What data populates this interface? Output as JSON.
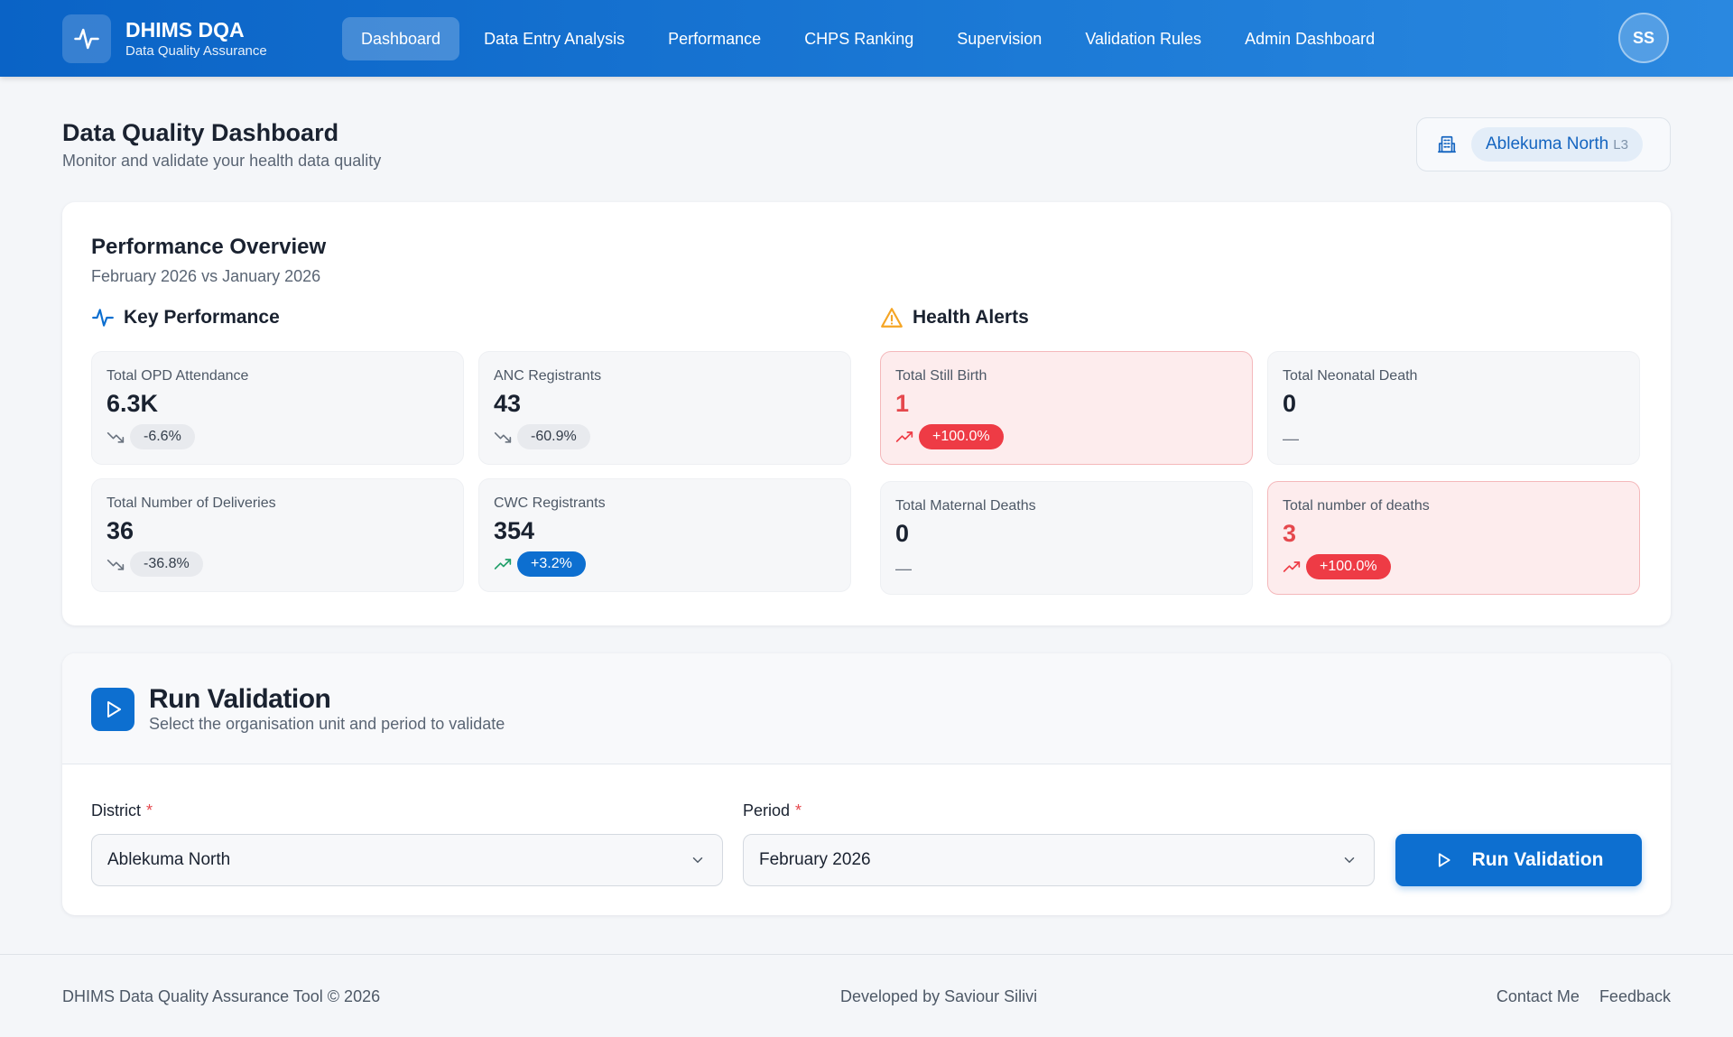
{
  "app": {
    "title": "DHIMS DQA",
    "subtitle": "Data Quality Assurance",
    "avatar_initials": "SS"
  },
  "nav": {
    "items": [
      {
        "label": "Dashboard",
        "active": true
      },
      {
        "label": "Data Entry Analysis"
      },
      {
        "label": "Performance"
      },
      {
        "label": "CHPS Ranking"
      },
      {
        "label": "Supervision"
      },
      {
        "label": "Validation Rules"
      },
      {
        "label": "Admin Dashboard"
      }
    ]
  },
  "header": {
    "title": "Data Quality Dashboard",
    "subtitle": "Monitor and validate your health data quality",
    "org_unit": {
      "name": "Ablekuma North",
      "level": "L3",
      "icon": "building-icon"
    }
  },
  "performance": {
    "title": "Performance Overview",
    "subtitle": "February 2026 vs January 2026",
    "key_title": "Key Performance",
    "alerts_title": "Health Alerts",
    "key_metrics": [
      {
        "label": "Total OPD Attendance",
        "value": "6.3K",
        "change": "-6.6%",
        "trend": "down"
      },
      {
        "label": "ANC Registrants",
        "value": "43",
        "change": "-60.9%",
        "trend": "down"
      },
      {
        "label": "Total Number of Deliveries",
        "value": "36",
        "change": "-36.8%",
        "trend": "down"
      },
      {
        "label": "CWC Registrants",
        "value": "354",
        "change": "+3.2%",
        "trend": "up"
      }
    ],
    "alerts": [
      {
        "label": "Total Still Birth",
        "value": "1",
        "change": "+100.0%",
        "trend": "danger"
      },
      {
        "label": "Total Neonatal Death",
        "value": "0",
        "change": "—",
        "trend": "flat"
      },
      {
        "label": "Total Maternal Deaths",
        "value": "0",
        "change": "—",
        "trend": "flat"
      },
      {
        "label": "Total number of deaths",
        "value": "3",
        "change": "+100.0%",
        "trend": "danger"
      }
    ]
  },
  "validation": {
    "title": "Run Validation",
    "subtitle": "Select the organisation unit and period to validate",
    "district_label": "District",
    "district_value": "Ablekuma North",
    "period_label": "Period",
    "period_value": "February 2026",
    "required_mark": "*",
    "run_label": "Run Validation"
  },
  "footer": {
    "left": "DHIMS Data Quality Assurance Tool © 2026",
    "center": "Developed by Saviour Silivi",
    "links": [
      "Contact Me",
      "Feedback"
    ]
  },
  "colors": {
    "brand": "#0d6fd0",
    "danger": "#ee3b45",
    "success": "#22a06b",
    "warning": "#f5a524"
  }
}
